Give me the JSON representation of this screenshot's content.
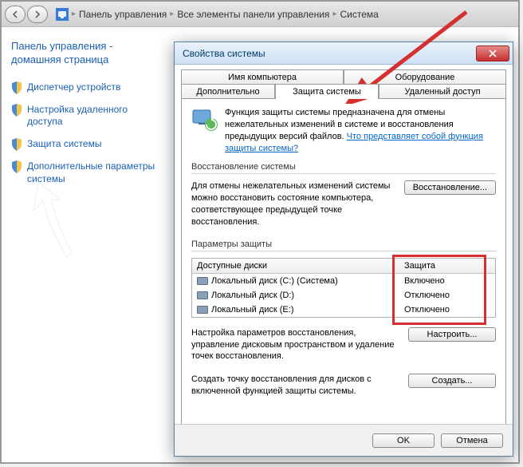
{
  "breadcrumb": {
    "item1": "Панель управления",
    "item2": "Все элементы панели управления",
    "item3": "Система"
  },
  "sidebar": {
    "home": "Панель управления - домашняя страница",
    "items": [
      "Диспетчер устройств",
      "Настройка удаленного доступа",
      "Защита системы",
      "Дополнительные параметры системы"
    ]
  },
  "dialog": {
    "title": "Свойства системы",
    "tabs_top": [
      "Имя компьютера",
      "Оборудование"
    ],
    "tabs_bottom": [
      "Дополнительно",
      "Защита системы",
      "Удаленный доступ"
    ],
    "active_tab": "Защита системы",
    "intro_text": "Функция защиты системы предназначена для отмены нежелательных изменений в системе и восстановления предыдущих версий файлов. ",
    "intro_link": "Что представляет собой функция защиты системы?",
    "restore": {
      "label": "Восстановление системы",
      "text": "Для отмены нежелательных изменений системы можно восстановить состояние компьютера, соответствующее предыдущей точке восстановления.",
      "button": "Восстановление..."
    },
    "protect": {
      "label": "Параметры защиты",
      "table": {
        "col_drive": "Доступные диски",
        "col_status": "Защита",
        "rows": [
          {
            "name": "Локальный диск (C:) (Система)",
            "status": "Включено"
          },
          {
            "name": "Локальный диск (D:)",
            "status": "Отключено"
          },
          {
            "name": "Локальный диск (E:)",
            "status": "Отключено"
          }
        ]
      },
      "config_text": "Настройка параметров восстановления, управление дисковым пространством и удаление точек восстановления.",
      "config_button": "Настроить...",
      "create_text": "Создать точку восстановления для дисков с включенной функцией защиты системы.",
      "create_button": "Создать..."
    },
    "footer": {
      "ok": "OK",
      "cancel": "Отмена"
    }
  }
}
